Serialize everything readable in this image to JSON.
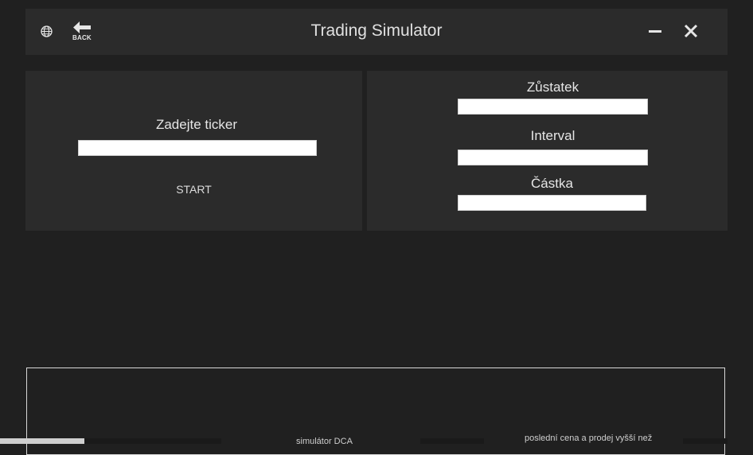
{
  "window": {
    "title": "Trading Simulator",
    "back_label": "BACK"
  },
  "left_panel": {
    "ticker_label": "Zadejte ticker",
    "ticker_value": "",
    "start_label": "START"
  },
  "right_panel": {
    "balance_label": "Zůstatek",
    "balance_value": "",
    "interval_label": "Interval",
    "interval_value": "",
    "amount_label": "Částka",
    "amount_value": ""
  },
  "bottom": {
    "text_left": "simulátor DCA",
    "text_right": "poslední cena a prodej vyšší než"
  },
  "colors": {
    "background": "#202020",
    "panel": "#2b2b2b",
    "text": "#e6e6e6",
    "input": "#ffffff"
  },
  "icons": {
    "globe": "globe-icon",
    "back": "back-arrow-icon",
    "minimize": "minimize-icon",
    "close": "close-icon"
  }
}
